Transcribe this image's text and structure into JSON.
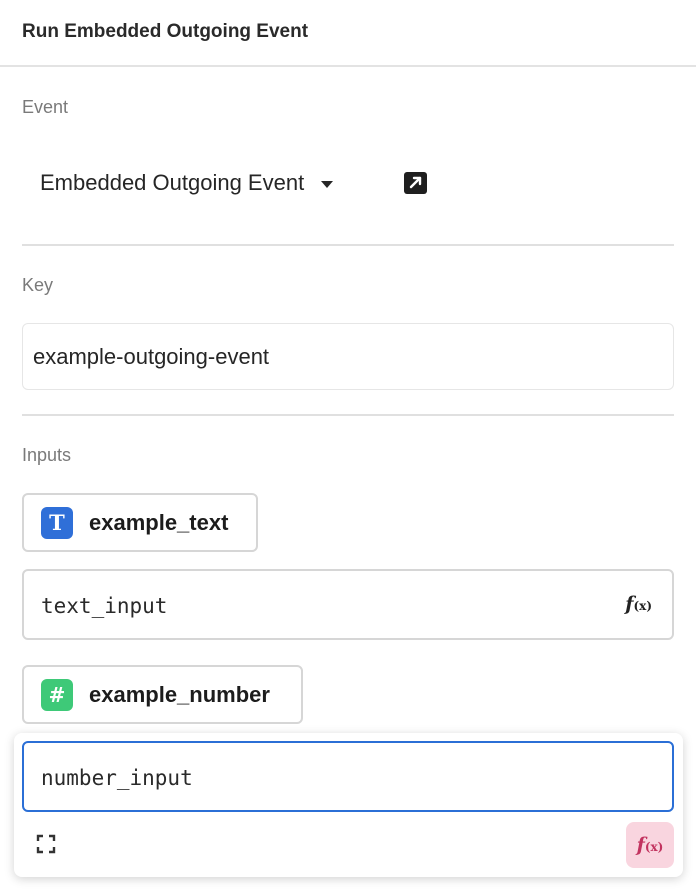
{
  "header": {
    "title": "Run Embedded Outgoing Event"
  },
  "event": {
    "label": "Event",
    "selected": "Embedded Outgoing Event"
  },
  "key": {
    "label": "Key",
    "value": "example-outgoing-event"
  },
  "inputs": {
    "label": "Inputs",
    "items": [
      {
        "type_icon": "T",
        "name": "example_text",
        "value": "text_input",
        "fx": "f",
        "fx_sub": "(x)"
      },
      {
        "type_icon": "#",
        "name": "example_number",
        "value": "number_input",
        "fx": "f",
        "fx_sub": "(x)"
      }
    ]
  },
  "colors": {
    "text_type": "#2f6fd8",
    "number_type": "#3ec978",
    "focus_border": "#2b6fd6",
    "fx_active_bg": "#f9d5df",
    "fx_active_text": "#c2335f"
  }
}
